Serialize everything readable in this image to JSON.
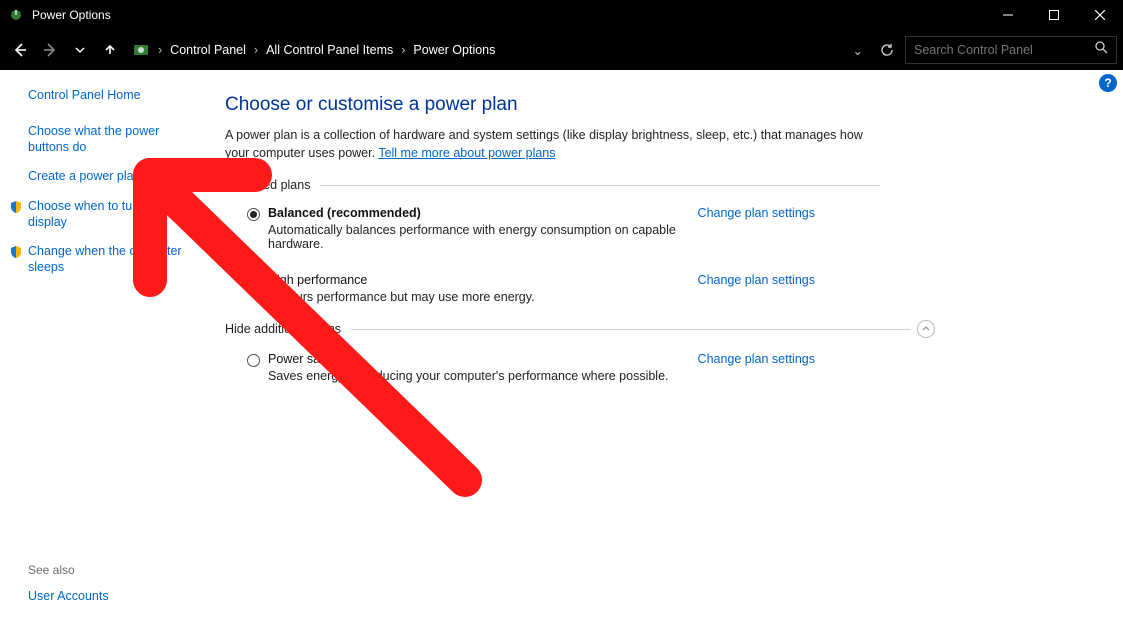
{
  "window": {
    "title": "Power Options",
    "minimize": "Minimize",
    "maximize": "Maximize",
    "close": "Close"
  },
  "breadcrumb": {
    "root": "Control Panel",
    "mid": "All Control Panel Items",
    "leaf": "Power Options"
  },
  "search": {
    "placeholder": "Search Control Panel"
  },
  "sidebar": {
    "home": "Control Panel Home",
    "links": {
      "power_buttons": "Choose what the power buttons do",
      "create_plan": "Create a power plan",
      "turn_off_display": "Choose when to turn off the display",
      "computer_sleeps": "Change when the computer sleeps"
    },
    "see_also_label": "See also",
    "see_also_link": "User Accounts"
  },
  "main": {
    "heading": "Choose or customise a power plan",
    "intro": "A power plan is a collection of hardware and system settings (like display brightness, sleep, etc.) that manages how your computer uses power. ",
    "intro_link": "Tell me more about power plans",
    "preferred_label": "Preferred plans",
    "hide_label": "Hide additional plans",
    "change_link": "Change plan settings",
    "plans": {
      "balanced": {
        "title": "Balanced (recommended)",
        "desc": "Automatically balances performance with energy consumption on capable hardware."
      },
      "high_perf": {
        "title": "High performance",
        "desc": "Favours performance but may use more energy."
      },
      "power_saver": {
        "title": "Power saver",
        "desc": "Saves energy by reducing your computer's performance where possible."
      }
    }
  },
  "help_tooltip": "?"
}
